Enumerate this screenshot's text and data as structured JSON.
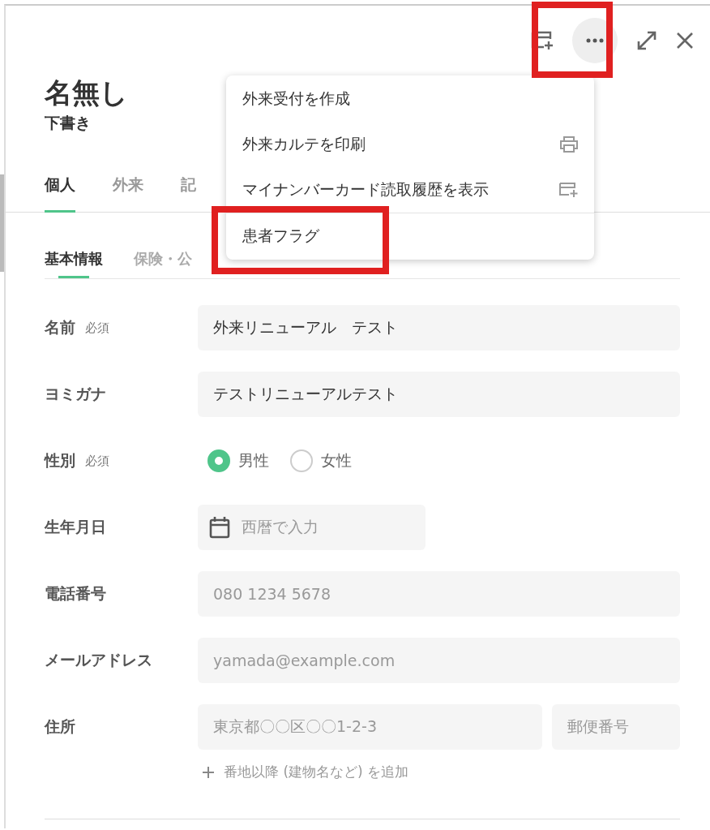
{
  "header": {
    "title": "名無し",
    "status": "下書き"
  },
  "tabs": [
    {
      "label": "個人",
      "selected": true
    },
    {
      "label": "外来",
      "selected": false
    },
    {
      "label": "記",
      "selected": false
    }
  ],
  "subtabs": [
    {
      "label": "基本情報",
      "selected": true
    },
    {
      "label": "保険・公",
      "selected": false
    }
  ],
  "menu": {
    "items": [
      {
        "label": "外来受付を作成",
        "kind": "plain",
        "divider_before": false
      },
      {
        "label": "外来カルテを印刷",
        "kind": "print",
        "divider_before": false
      },
      {
        "label": "マイナンバーカード読取履歴を表示",
        "kind": "card",
        "divider_before": false
      },
      {
        "label": "患者フラグ",
        "kind": "plain",
        "divider_before": true
      }
    ]
  },
  "form": [
    {
      "kind": "text",
      "label": "名前",
      "required": "必須",
      "value": "外来リニューアル　テスト"
    },
    {
      "kind": "text",
      "label": "ヨミガナ",
      "value": "テストリニューアルテスト"
    },
    {
      "kind": "radio",
      "label": "性別",
      "required": "必須",
      "options": [
        {
          "label": "男性",
          "selected": true
        },
        {
          "label": "女性",
          "selected": false
        }
      ]
    },
    {
      "kind": "date",
      "label": "生年月日",
      "placeholder": "西暦で入力"
    },
    {
      "kind": "text",
      "label": "電話番号",
      "placeholder": "080 1234 5678"
    },
    {
      "kind": "text",
      "label": "メールアドレス",
      "placeholder": "yamada@example.com"
    },
    {
      "kind": "address",
      "label": "住所",
      "placeholder": "東京都〇〇区〇〇1-2-3",
      "postal_placeholder": "郵便番号",
      "add_link": "番地以降 (建物名など) を追加"
    }
  ]
}
